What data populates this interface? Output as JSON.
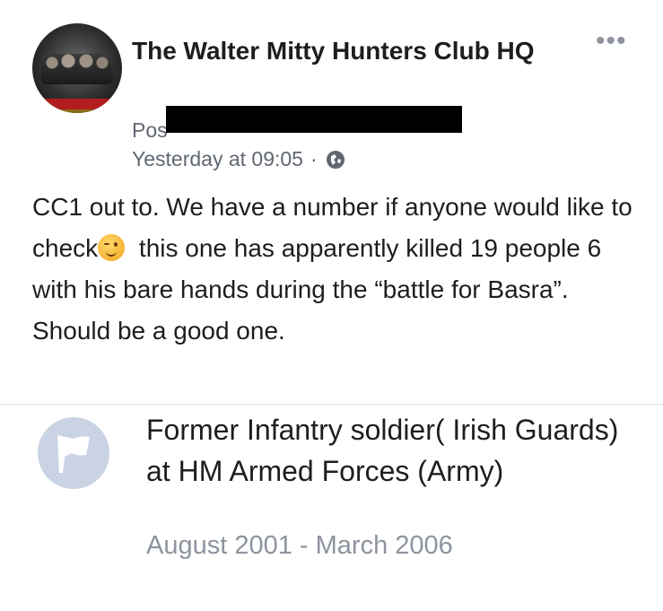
{
  "post": {
    "group_name": "The Walter Mitty Hunters Club HQ",
    "posted_prefix": "Pos",
    "timestamp": "Yesterday at 09:05",
    "separator": "·",
    "body_before_emoji": "CC1 out to. We have a number if anyone would like to check",
    "emoji": "winking-face",
    "body_after_emoji": " this one has apparently killed 19 people 6 with his bare hands during the “battle for Basra”. Should be a good one."
  },
  "profile_card": {
    "job": "Former Infantry soldier( Irish Guards) at HM Armed Forces (Army)",
    "dates": "August 2001 - March 2006",
    "icon": "flag-icon"
  },
  "colors": {
    "text": "#1c1e21",
    "meta": "#606770",
    "muted": "#8d949e",
    "badge_bg": "#c9d3e3"
  }
}
